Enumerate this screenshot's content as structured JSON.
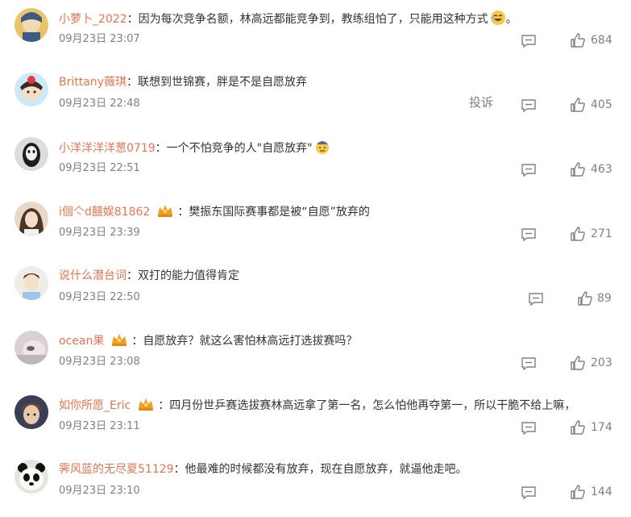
{
  "report_label": "投诉",
  "comments": [
    {
      "user": "小萝卜_2022",
      "sep": "：",
      "text": "因为每次竞争名额，林高远都能竞争到，教练组怕了，只能用这种方式",
      "suffix": "。",
      "time": "09月23日 23:07",
      "likes": "684"
    },
    {
      "user": "Brittany薇琪",
      "sep": "：",
      "text": "联想到世锦赛，胖是不是自愿放弃",
      "time": "09月23日 22:48",
      "likes": "405"
    },
    {
      "user": "小洋洋洋洋葱0719",
      "sep": "：",
      "text": "一个不怕竞争的人\"自愿放弃\"",
      "time": "09月23日 22:51",
      "likes": "463"
    },
    {
      "user": "i個亽d囍娱81862",
      "sep": "：",
      "text": "樊振东国际赛事都是被“自愿”放弃的",
      "time": "09月23日 23:39",
      "likes": "271"
    },
    {
      "user": "说什么潜台词",
      "sep": "：",
      "text": "双打的能力值得肯定",
      "time": "09月23日 22:50",
      "likes": "89"
    },
    {
      "user": "ocean果",
      "sep": "：",
      "text": "自愿放弃？就这么害怕林高远打选拔赛吗？",
      "time": "09月23日 23:08",
      "likes": "203"
    },
    {
      "user": "如你所愿_Eric",
      "sep": "：",
      "text": "四月份世乒赛选拔赛林高远拿了第一名，怎么怕他再夺第一，所以干脆不给上嘛，",
      "time": "09月23日 23:11",
      "likes": "174"
    },
    {
      "user": "霁风蓝的无尽夏51129",
      "sep": "：",
      "text": "他最难的时候都没有放弃，现在自愿放弃，就逼他走吧。",
      "time": "09月23日 23:10",
      "likes": "144"
    }
  ],
  "colors": {
    "username": "#eb7350",
    "text": "#333333",
    "meta": "#808080",
    "badge": "#f0a020"
  }
}
